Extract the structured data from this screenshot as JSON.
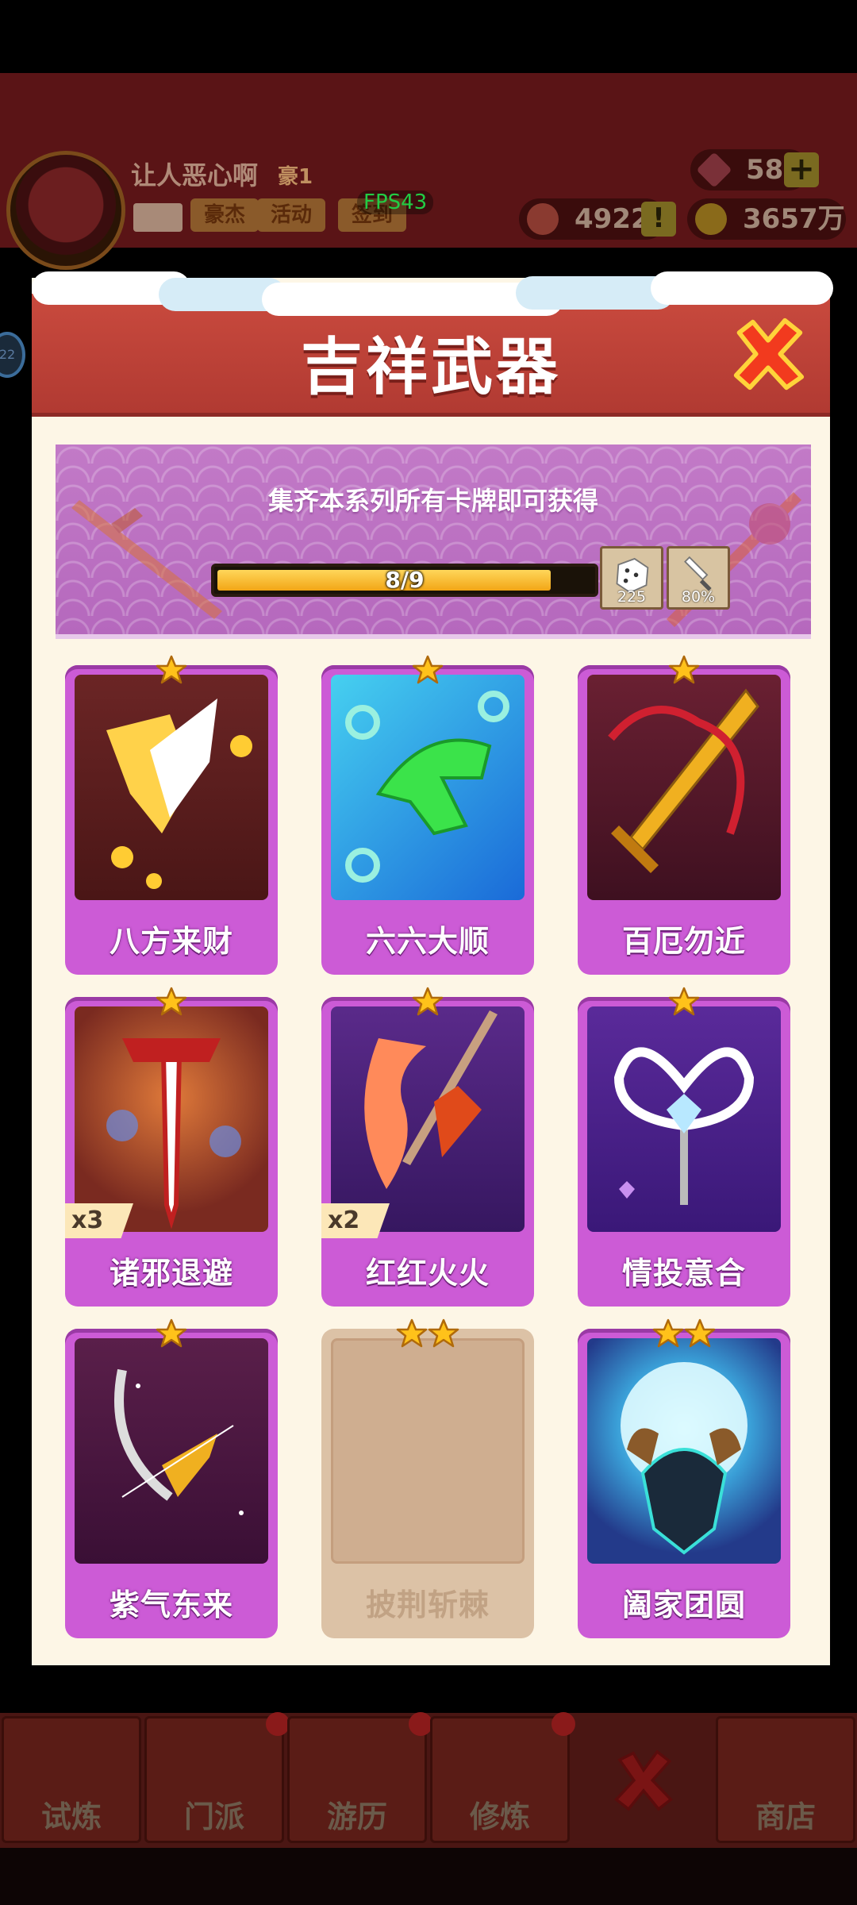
{
  "hud": {
    "player_name": "让人恶心啊",
    "vip_label": "豪1",
    "buttons": [
      "豪杰",
      "活动",
      "签到"
    ],
    "fps": "FPS43",
    "gems": "582",
    "tokens": "4922",
    "coins": "3657万",
    "side_badge": "22"
  },
  "modal": {
    "title": "吉祥武器",
    "banner_text": "集齐本系列所有卡牌即可获得",
    "progress_text": "8/9",
    "progress_value": 0.889,
    "rewards": [
      {
        "icon": "dice-icon",
        "caption": "225"
      },
      {
        "icon": "dagger-icon",
        "caption": "80%"
      }
    ],
    "cards": [
      {
        "name": "八方来财",
        "stars": 1,
        "multiplier": "",
        "owned": true,
        "icon": "golden-blade-icon"
      },
      {
        "name": "六六大顺",
        "stars": 1,
        "multiplier": "",
        "owned": true,
        "icon": "six-hand-icon"
      },
      {
        "name": "百厄勿近",
        "stars": 1,
        "multiplier": "",
        "owned": true,
        "icon": "golden-sword-icon"
      },
      {
        "name": "诸邪退避",
        "stars": 1,
        "multiplier": "x3",
        "owned": true,
        "icon": "red-sword-icon"
      },
      {
        "name": "红红火火",
        "stars": 1,
        "multiplier": "x2",
        "owned": true,
        "icon": "fire-spear-icon"
      },
      {
        "name": "情投意合",
        "stars": 1,
        "multiplier": "",
        "owned": true,
        "icon": "heart-wand-icon"
      },
      {
        "name": "紫气东来",
        "stars": 1,
        "multiplier": "",
        "owned": true,
        "icon": "purple-scythe-icon"
      },
      {
        "name": "披荆斩棘",
        "stars": 2,
        "multiplier": "",
        "owned": false,
        "icon": "locked-card"
      },
      {
        "name": "阖家团圆",
        "stars": 2,
        "multiplier": "",
        "owned": true,
        "icon": "moon-orb-icon"
      }
    ]
  },
  "nav": [
    "试炼",
    "门派",
    "游历",
    "修炼",
    "商店"
  ],
  "colors": {
    "header_red": "#c94a3e",
    "card_purple": "#cc5bd6",
    "banner_purple": "#c27ac7",
    "progress_yellow": "#f2a516",
    "modal_bg": "#fdf6e6"
  }
}
